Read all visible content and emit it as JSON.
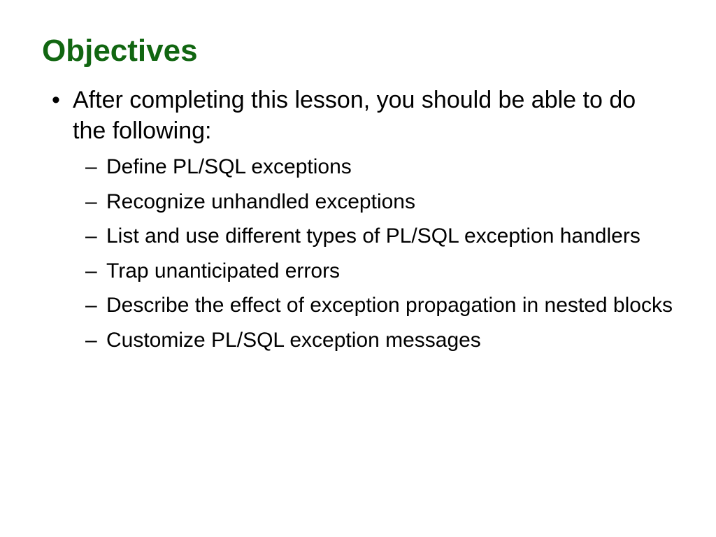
{
  "title": "Objectives",
  "intro": "After completing this lesson, you should be able to do the following:",
  "bullets": [
    "Define PL/SQL exceptions",
    "Recognize unhandled exceptions",
    "List and use different types of PL/SQL exception handlers",
    "Trap unanticipated errors",
    "Describe the effect of exception propagation in nested blocks",
    "Customize PL/SQL exception messages"
  ]
}
